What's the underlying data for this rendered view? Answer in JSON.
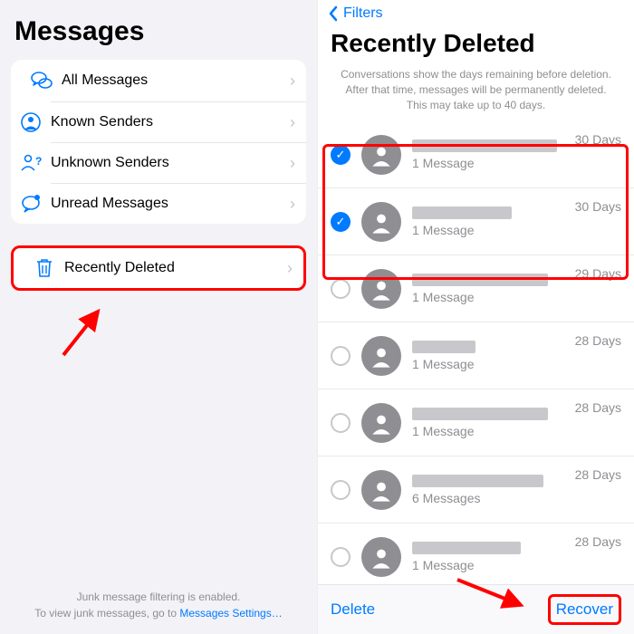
{
  "left": {
    "title": "Messages",
    "groups": [
      {
        "items": [
          {
            "icon": "chat-bubbles",
            "label": "All Messages"
          },
          {
            "icon": "person-circle",
            "label": "Known Senders"
          },
          {
            "icon": "person-question",
            "label": "Unknown Senders"
          },
          {
            "icon": "chat-dot",
            "label": "Unread Messages"
          }
        ]
      },
      {
        "items": [
          {
            "icon": "trash",
            "label": "Recently Deleted",
            "highlight": true
          }
        ]
      }
    ],
    "footer_line1": "Junk message filtering is enabled.",
    "footer_line2_pre": "To view junk messages, go to ",
    "footer_link": "Messages Settings…"
  },
  "right": {
    "back_label": "Filters",
    "title": "Recently Deleted",
    "subtitle": "Conversations show the days remaining before deletion. After that time, messages will be permanently deleted. This may take up to 40 days.",
    "messages": [
      {
        "selected": true,
        "name_width": 160,
        "count_label": "1 Message",
        "days_label": "30 Days"
      },
      {
        "selected": true,
        "name_width": 110,
        "count_label": "1 Message",
        "days_label": "30 Days"
      },
      {
        "selected": false,
        "name_width": 150,
        "count_label": "1 Message",
        "days_label": "29 Days"
      },
      {
        "selected": false,
        "name_width": 70,
        "count_label": "1 Message",
        "days_label": "28 Days"
      },
      {
        "selected": false,
        "name_width": 150,
        "count_label": "1 Message",
        "days_label": "28 Days"
      },
      {
        "selected": false,
        "name_width": 145,
        "count_label": "6 Messages",
        "days_label": "28 Days"
      },
      {
        "selected": false,
        "name_width": 120,
        "count_label": "1 Message",
        "days_label": "28 Days"
      }
    ],
    "delete_label": "Delete",
    "recover_label": "Recover"
  }
}
